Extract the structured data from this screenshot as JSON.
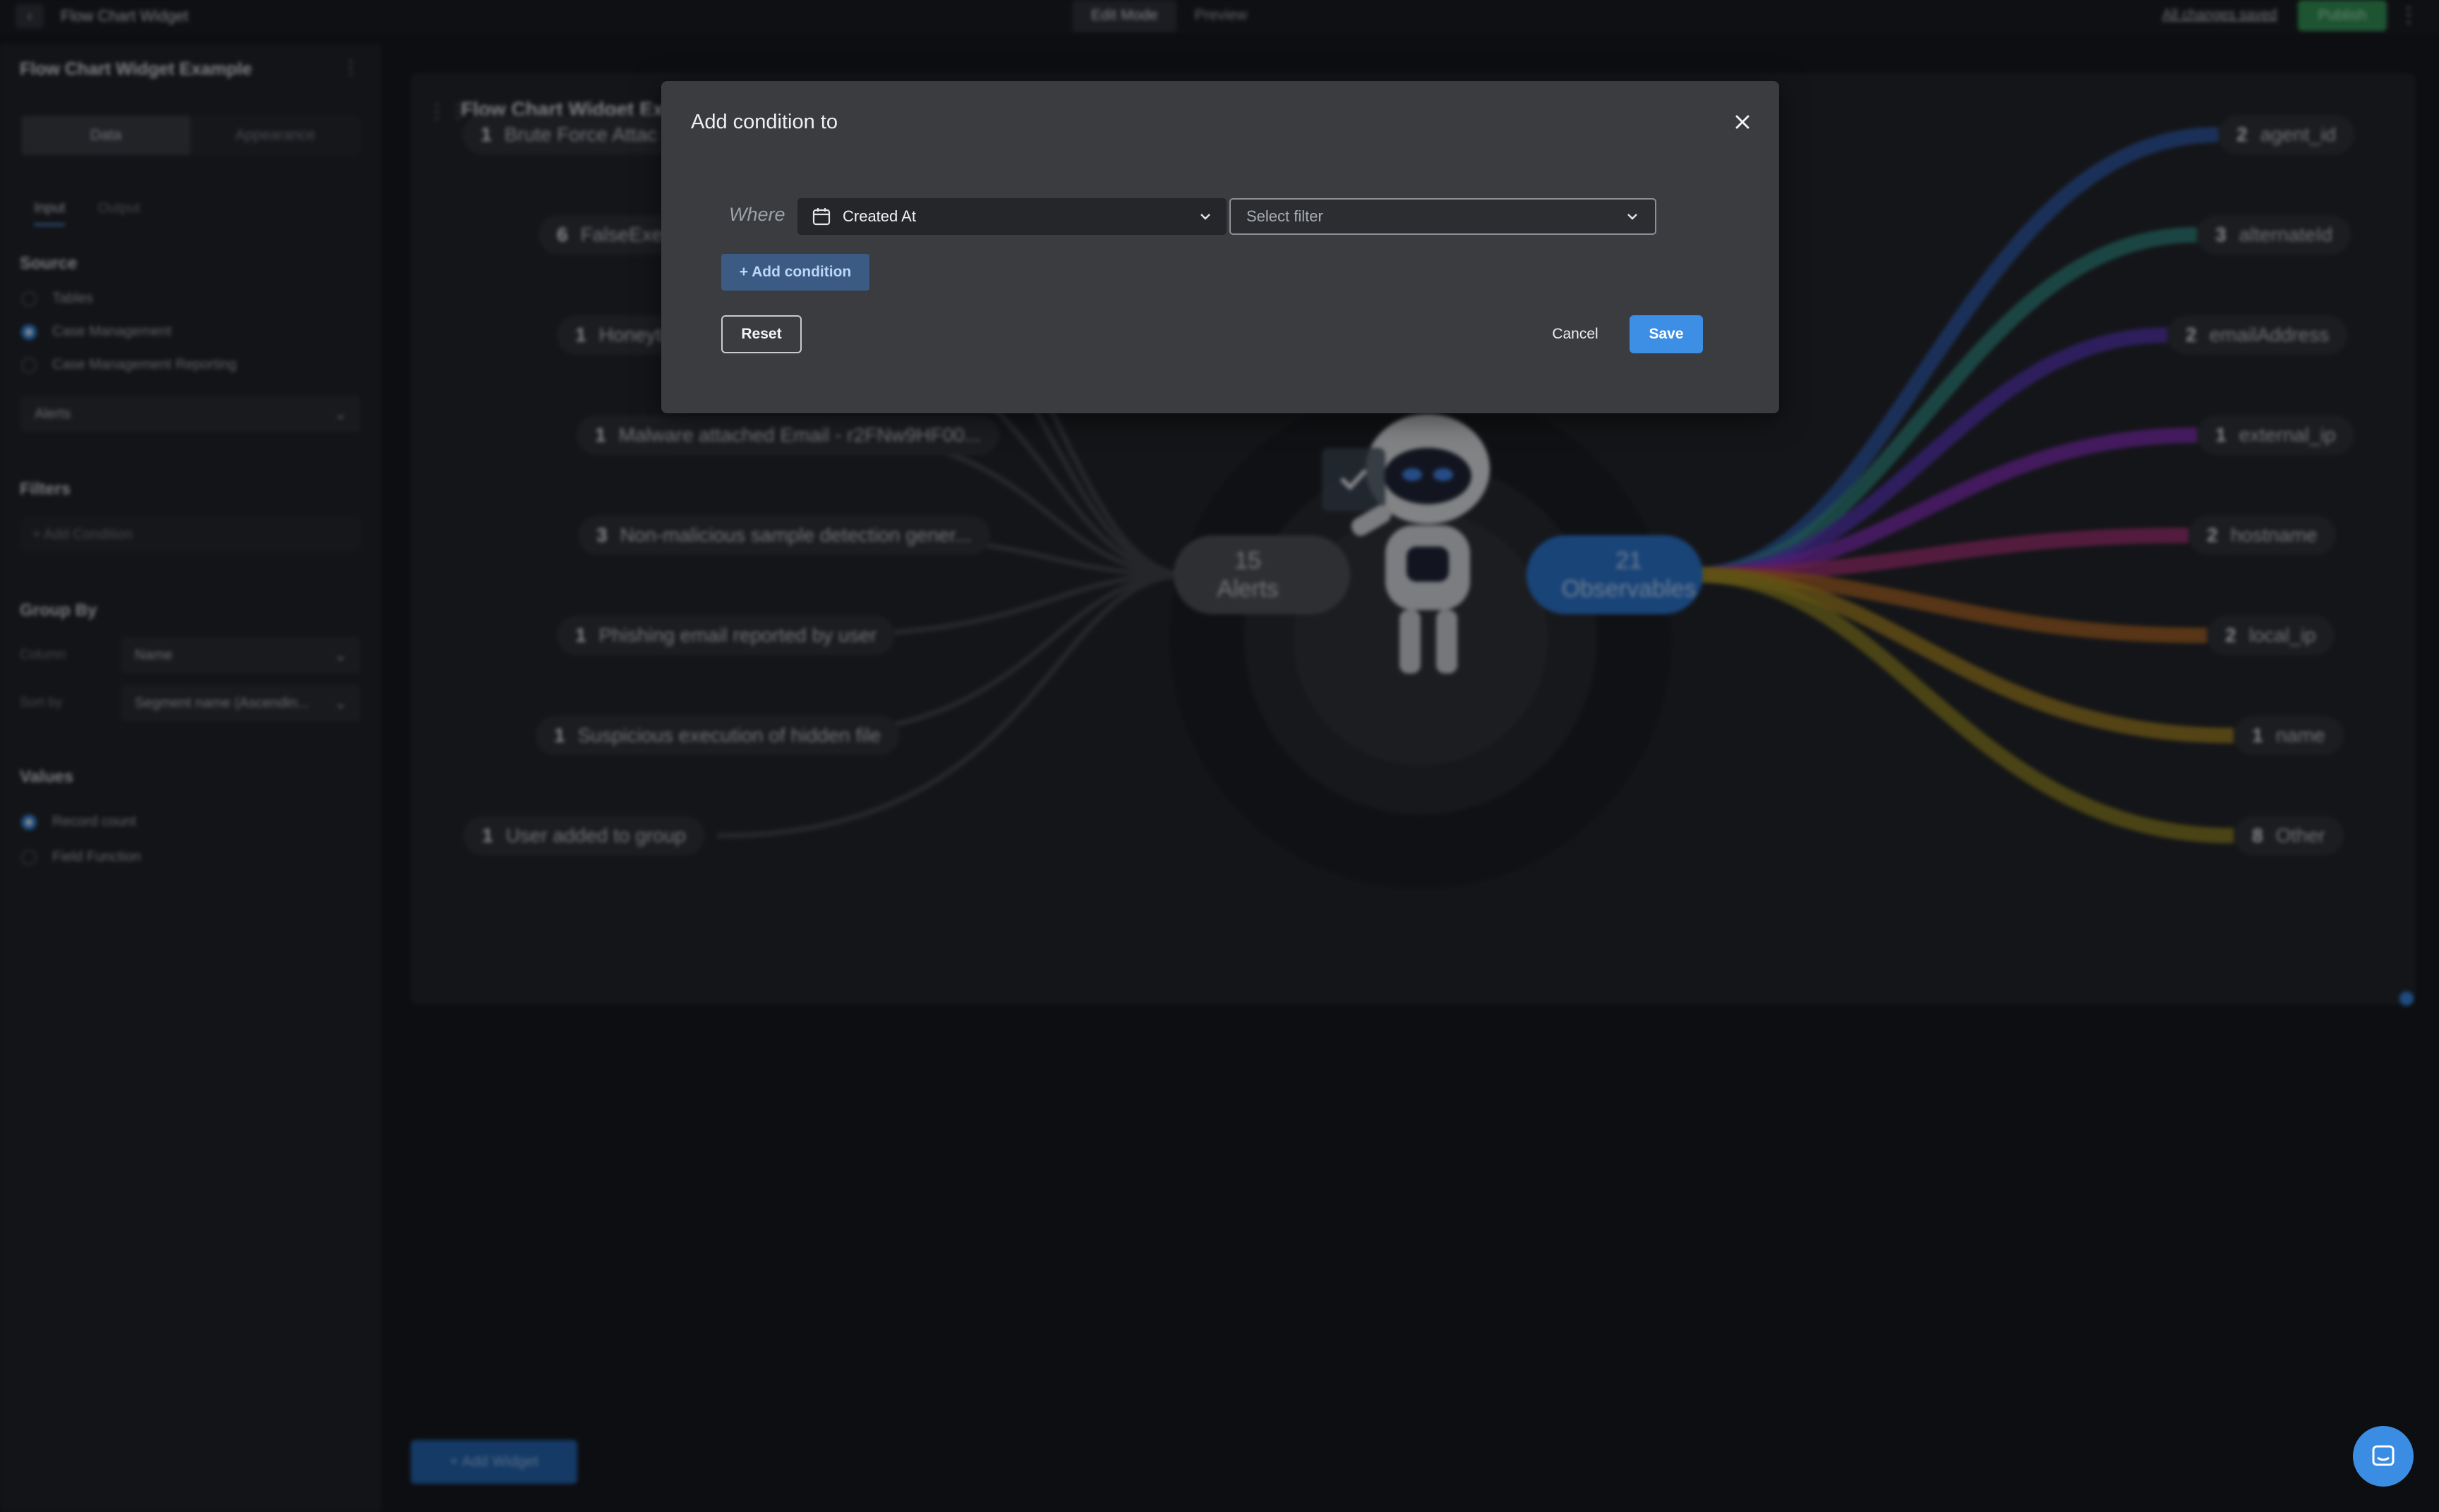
{
  "app": {
    "title": "Flow Chart Widget",
    "modes": [
      "Edit Mode",
      "Preview"
    ],
    "saved_status": "All changes saved",
    "publish_label": "Publish"
  },
  "sidebar": {
    "title": "Flow Chart Widget Example",
    "tabs": [
      "Data",
      "Appearance"
    ],
    "io_tabs": [
      "Input",
      "Output"
    ],
    "source_heading": "Source",
    "sources": [
      {
        "label": "Tables",
        "selected": false
      },
      {
        "label": "Case Management",
        "selected": true
      },
      {
        "label": "Case Management Reporting",
        "selected": false
      }
    ],
    "source_select": "Alerts",
    "filters_heading": "Filters",
    "add_condition": "+ Add Condition",
    "group_by_heading": "Group By",
    "column_label": "Column",
    "column_value": "Name",
    "sort_label": "Sort by",
    "sort_value": "Segment name (Ascendin...",
    "values_heading": "Values",
    "values": [
      {
        "label": "Record count",
        "selected": true
      },
      {
        "label": "Field Function",
        "selected": false
      }
    ]
  },
  "panel": {
    "title": "Flow Chart Widget Ex",
    "left_items": [
      {
        "count": "1",
        "label": "Brute Force Attac"
      },
      {
        "count": "6",
        "label": "FalseExecu"
      },
      {
        "count": "1",
        "label": "Honeytoken activity"
      },
      {
        "count": "1",
        "label": "Malware attached Email - r2FNw9HF00..."
      },
      {
        "count": "3",
        "label": "Non-malicious sample detection gener..."
      },
      {
        "count": "1",
        "label": "Phishing email reported by user"
      },
      {
        "count": "1",
        "label": "Suspicious execution of hidden file"
      },
      {
        "count": "1",
        "label": "User added to group"
      }
    ],
    "center": {
      "alerts_count": "15",
      "alerts_label": "Alerts",
      "observables_count": "21",
      "observables_label": "Observables"
    },
    "right_items": [
      {
        "count": "2",
        "label": "agent_id",
        "color": "#2f5fb5"
      },
      {
        "count": "3",
        "label": "alternateId",
        "color": "#2f8f86"
      },
      {
        "count": "2",
        "label": "emailAddress",
        "color": "#5a36c0"
      },
      {
        "count": "1",
        "label": "external_ip",
        "color": "#8a2cc0"
      },
      {
        "count": "2",
        "label": "hostname",
        "color": "#b0307a"
      },
      {
        "count": "2",
        "label": "local_ip",
        "color": "#b86a1f"
      },
      {
        "count": "1",
        "label": "name",
        "color": "#b0891c"
      },
      {
        "count": "8",
        "label": "Other",
        "color": "#9a8a1c"
      }
    ]
  },
  "add_widget_label": "+ Add Widget",
  "modal": {
    "title": "Add condition to",
    "where_label": "Where",
    "field_value": "Created At",
    "filter_placeholder": "Select filter",
    "add_condition_label": "+ Add condition",
    "reset_label": "Reset",
    "cancel_label": "Cancel",
    "save_label": "Save"
  },
  "colors": {
    "accent": "#3d8fe6",
    "publish": "#2f8c4e",
    "modal_bg": "#3a3c40"
  },
  "icons": [
    "chevron-left-icon",
    "kebab-icon",
    "drag-handle-icon",
    "calendar-icon",
    "chevron-down-icon",
    "close-icon",
    "chat-icon"
  ]
}
